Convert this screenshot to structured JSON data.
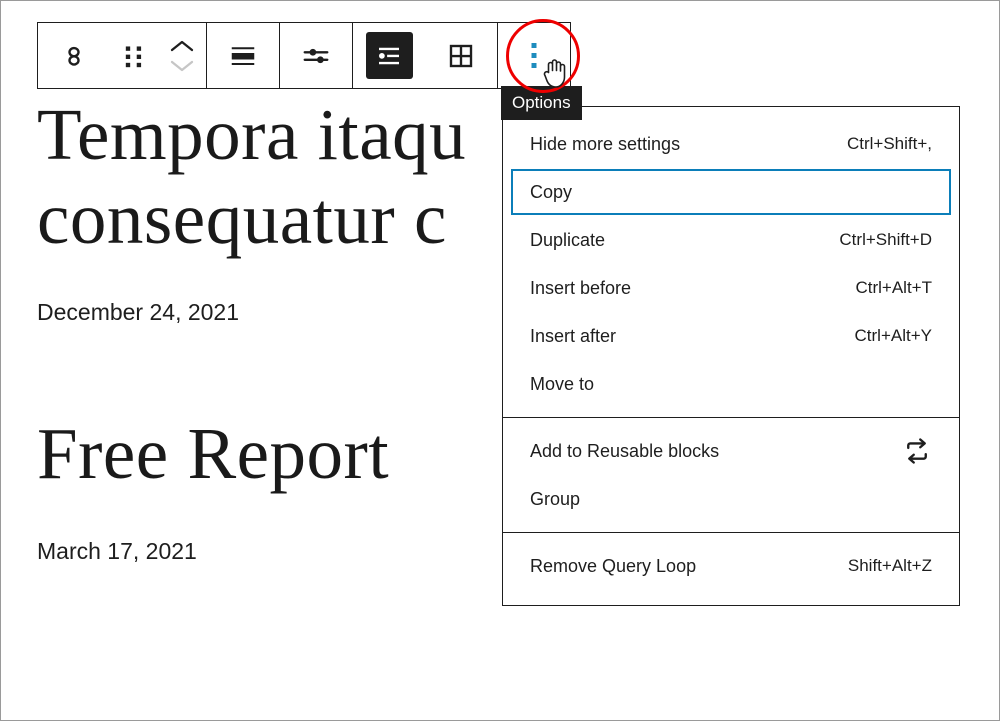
{
  "toolbar": {
    "name": "block-toolbar",
    "buttons": [
      {
        "name": "query-loop-block-icon",
        "label": "Query Loop",
        "icon": "query-loop-icon"
      },
      {
        "name": "drag-handle",
        "label": "Drag",
        "icon": "drag-dots-icon"
      },
      {
        "name": "move-updown",
        "label": "Move up / Move down",
        "icon": "chevron-up-down-icon"
      },
      {
        "name": "align-wide",
        "label": "Align",
        "icon": "align-wide-icon"
      },
      {
        "name": "display-settings",
        "label": "Display settings",
        "icon": "sliders-icon"
      },
      {
        "name": "list-view",
        "label": "List view",
        "icon": "list-view-icon"
      },
      {
        "name": "grid-view",
        "label": "Grid view",
        "icon": "grid-view-icon"
      },
      {
        "name": "options",
        "label": "Options",
        "icon": "more-vertical-icon"
      }
    ],
    "active_button": "list-view",
    "highlight_color": "#1e8cbe",
    "annotation_color": "#ee0000"
  },
  "tooltip": {
    "text": "Options",
    "background": "#1e1e1e",
    "color": "#ffffff"
  },
  "menu": {
    "name": "options-dropdown",
    "focused_item": "Copy",
    "focus_color": "#0b7eb9",
    "sections": [
      {
        "items": [
          {
            "label": "Hide more settings",
            "shortcut": "Ctrl+Shift+,",
            "icon": null,
            "focused": false
          },
          {
            "label": "Copy",
            "shortcut": "",
            "icon": null,
            "focused": true
          },
          {
            "label": "Duplicate",
            "shortcut": "Ctrl+Shift+D",
            "icon": null,
            "focused": false
          },
          {
            "label": "Insert before",
            "shortcut": "Ctrl+Alt+T",
            "icon": null,
            "focused": false
          },
          {
            "label": "Insert after",
            "shortcut": "Ctrl+Alt+Y",
            "icon": null,
            "focused": false
          },
          {
            "label": "Move to",
            "shortcut": "",
            "icon": null,
            "focused": false
          }
        ]
      },
      {
        "items": [
          {
            "label": "Add to Reusable blocks",
            "shortcut": "",
            "icon": "reusable-blocks-icon",
            "focused": false
          },
          {
            "label": "Group",
            "shortcut": "",
            "icon": null,
            "focused": false
          }
        ]
      },
      {
        "items": [
          {
            "label": "Remove Query Loop",
            "shortcut": "Shift+Alt+Z",
            "icon": null,
            "focused": false
          }
        ]
      }
    ]
  },
  "content": {
    "posts": [
      {
        "title": "Tempora itaque consequatur c",
        "title_line1": "Tempora itaqu",
        "title_line2": "consequatur c",
        "date": "December 24, 2021"
      },
      {
        "title": "Free Report",
        "title_line1": "Free Report",
        "title_line2": "",
        "date": "March 17, 2021"
      }
    ]
  }
}
